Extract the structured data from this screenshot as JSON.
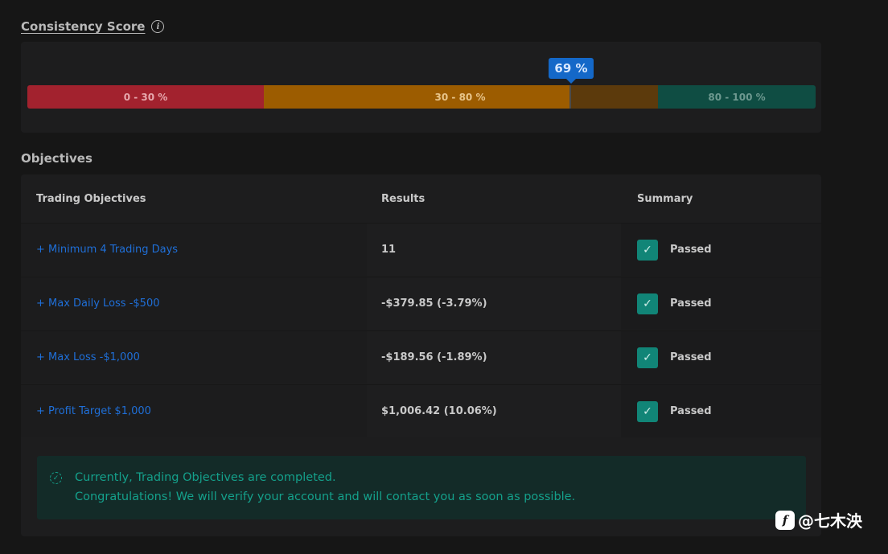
{
  "consistency": {
    "title": "Consistency Score",
    "info_icon": "i",
    "score_label": "69 %",
    "score": 69,
    "segments": [
      {
        "label": "0 - 30 %",
        "color": "#a2222e"
      },
      {
        "label": "30 - 80 %",
        "color": "#9c5c00"
      },
      {
        "label": "80 - 100 %",
        "color": "#0f4d43"
      }
    ]
  },
  "objectives": {
    "title": "Objectives",
    "columns": [
      "Trading Objectives",
      "Results",
      "Summary"
    ],
    "rows": [
      {
        "objective": "+ Minimum 4 Trading Days",
        "result": "11",
        "status": "Passed"
      },
      {
        "objective": "+ Max Daily Loss -$500",
        "result": "-$379.85 (-3.79%)",
        "status": "Passed"
      },
      {
        "objective": "+ Max Loss -$1,000",
        "result": "-$189.56 (-1.89%)",
        "status": "Passed"
      },
      {
        "objective": "+ Profit Target $1,000",
        "result": "$1,006.42 (10.06%)",
        "status": "Passed"
      }
    ],
    "check_icon": "✓",
    "notice_icon": "✓",
    "notice_line1": "Currently, Trading Objectives are completed.",
    "notice_line2": "Congratulations! We will verify your account and will contact you as soon as possible."
  },
  "watermark": {
    "icon": "f",
    "text": "@七木泱"
  },
  "colors": {
    "accent_blue": "#1468c8",
    "link_blue": "#1f6fd8",
    "success_green": "#118577"
  }
}
